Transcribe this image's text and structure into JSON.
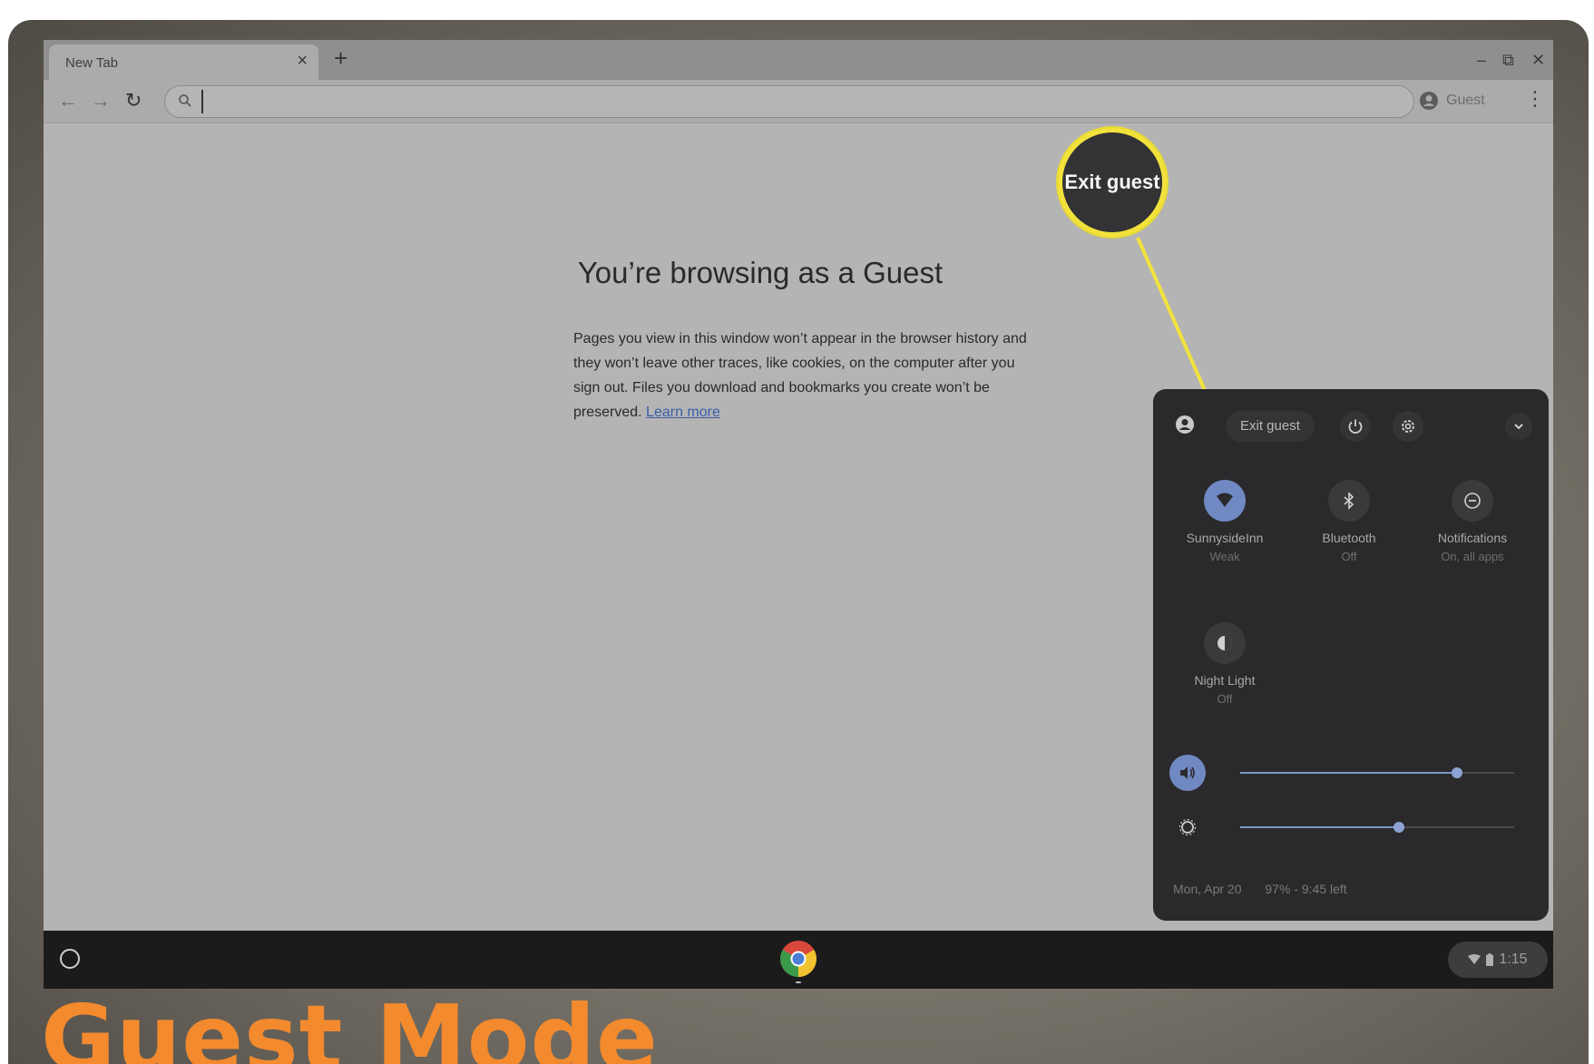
{
  "browser": {
    "tab_title": "New Tab",
    "tab_close": "×",
    "new_tab": "+",
    "window_controls": [
      "–",
      "⧉",
      "✕"
    ],
    "profile_label": "Guest",
    "omnibox_value": ""
  },
  "page": {
    "title": "You’re browsing as a Guest",
    "body": "Pages you view in this window won’t appear in the browser history and they won’t leave other traces, like cookies, on the computer after you sign out. Files you download and bookmarks you create won’t be preserved.",
    "learn_more": "Learn more"
  },
  "callout": {
    "text": "Exit guest",
    "color": "#f2e23c"
  },
  "quick_settings": {
    "exit_label": "Exit guest",
    "icons": [
      "avatar-icon",
      "power-icon",
      "gear-icon",
      "chevron-down-icon"
    ],
    "tiles": [
      {
        "label": "SunnysideInn",
        "sub": "Weak",
        "icon": "wifi-icon",
        "active": true
      },
      {
        "label": "Bluetooth",
        "sub": "Off",
        "icon": "bluetooth-icon",
        "active": false
      },
      {
        "label": "Notifications",
        "sub": "On, all apps",
        "icon": "notifications-icon",
        "active": false
      },
      {
        "label": "Night Light",
        "sub": "Off",
        "icon": "night-light-icon",
        "active": false
      }
    ],
    "volume_level": 0.79,
    "brightness_level": 0.58,
    "date": "Mon, Apr 20",
    "battery": "97% - 9:45 left"
  },
  "shelf": {
    "time": "1:15"
  },
  "banner": {
    "text": "Guest Mode"
  },
  "colors": {
    "accent": "#7089c2",
    "banner": "#f38a2e",
    "callout_ring": "#f2e23c"
  }
}
